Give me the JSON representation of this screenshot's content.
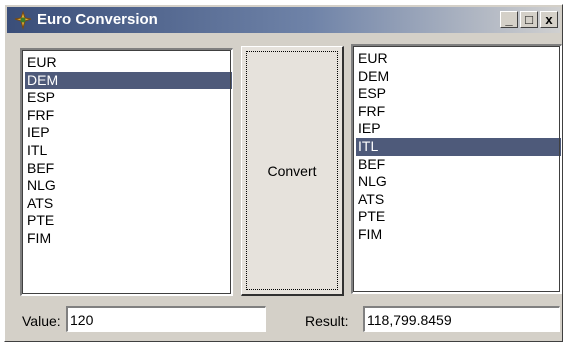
{
  "window": {
    "title": "Euro Conversion",
    "icon": "euro-app-icon",
    "controls": {
      "minimize": "_",
      "maximize": "□",
      "close": "x"
    },
    "colors": {
      "titlebar_start": "#3a4e79",
      "face": "#d4d0c8",
      "selection": "#4e5a7a"
    }
  },
  "from_list": {
    "items": [
      "EUR",
      "DEM",
      "ESP",
      "FRF",
      "IEP",
      "ITL",
      "BEF",
      "NLG",
      "ATS",
      "PTE",
      "FIM"
    ],
    "selected": "DEM"
  },
  "to_list": {
    "items": [
      "EUR",
      "DEM",
      "ESP",
      "FRF",
      "IEP",
      "ITL",
      "BEF",
      "NLG",
      "ATS",
      "PTE",
      "FIM"
    ],
    "selected": "ITL"
  },
  "convert_button": {
    "label": "Convert"
  },
  "value": {
    "label": "Value:",
    "text": "120"
  },
  "result": {
    "label": "Result:",
    "text": "118,799.8459"
  }
}
